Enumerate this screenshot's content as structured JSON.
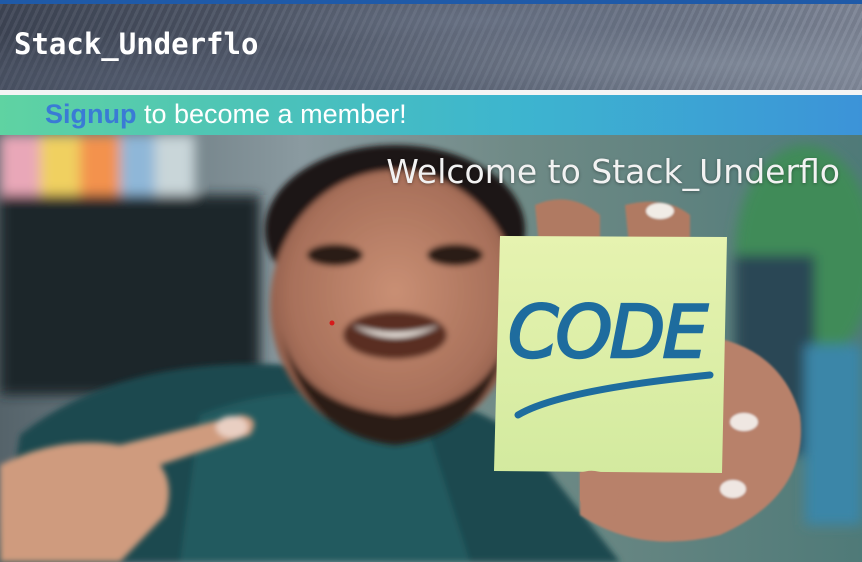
{
  "header": {
    "site_title": "Stack_Underflo"
  },
  "signup_banner": {
    "link_label": "Signup",
    "rest_text": " to become a member!"
  },
  "hero": {
    "heading": "Welcome to Stack_Underflo",
    "note_text": "CODE",
    "image_description_icon": "hero-photo"
  },
  "colors": {
    "top_strip": "#1f5aa8",
    "signup_link": "#3a7bd5",
    "banner_start": "#5fd3a2",
    "banner_end": "#3c93d8"
  }
}
